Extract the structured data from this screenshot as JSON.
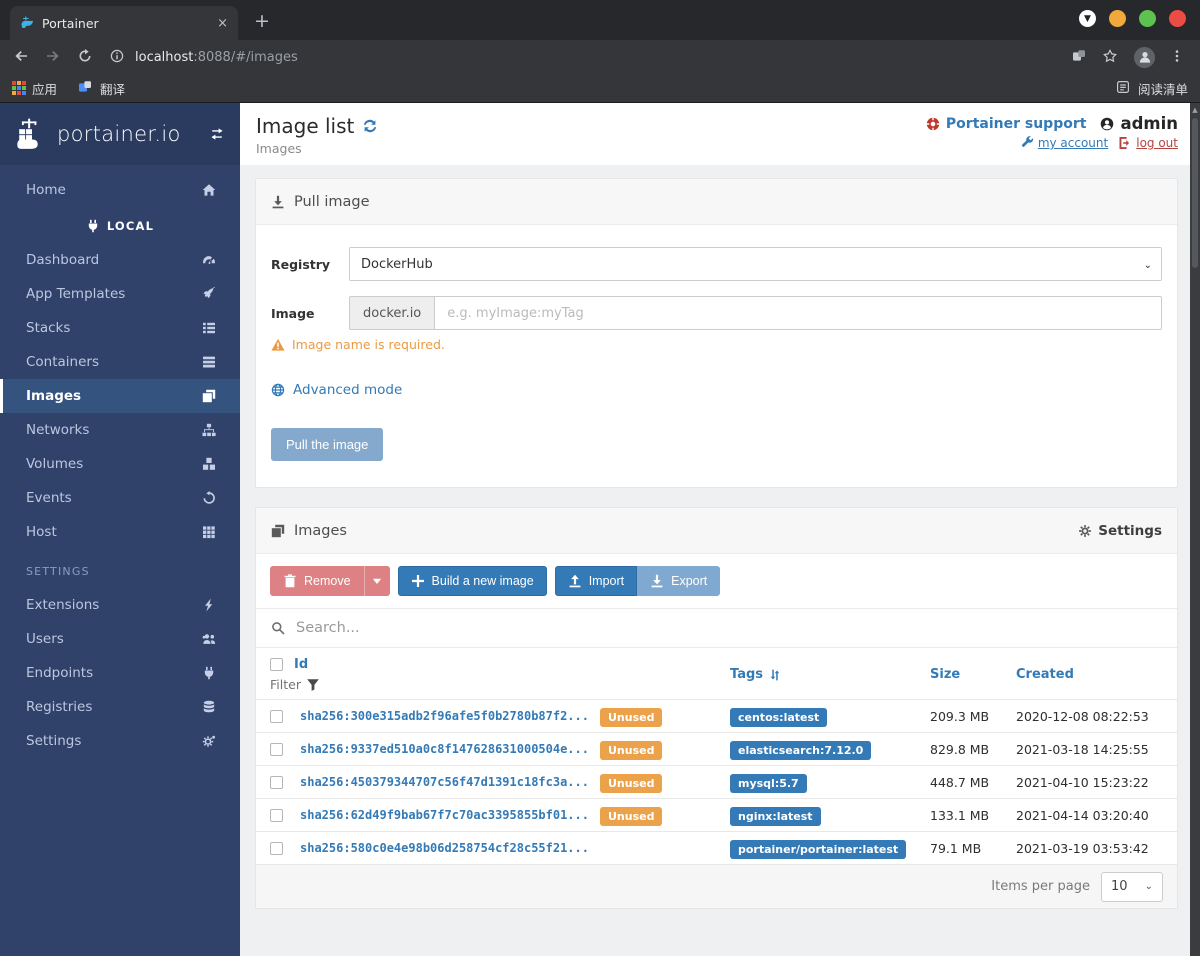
{
  "browser": {
    "tab_title": "Portainer",
    "new_tab": "+",
    "close_tab": "×",
    "url_host": "localhost",
    "url_rest": ":8088/#/images",
    "bookmarks": {
      "apps": "应用",
      "translate": "翻译",
      "reading_list": "阅读清单"
    }
  },
  "sidebar": {
    "logo_text": "portainer.io",
    "home": {
      "label": "Home",
      "icon": "home-icon"
    },
    "local_header": "LOCAL",
    "local_items": [
      {
        "label": "Dashboard",
        "icon": "dashboard-icon",
        "active": false
      },
      {
        "label": "App Templates",
        "icon": "rocket-icon",
        "active": false
      },
      {
        "label": "Stacks",
        "icon": "list-icon",
        "active": false
      },
      {
        "label": "Containers",
        "icon": "server-icon",
        "active": false
      },
      {
        "label": "Images",
        "icon": "images-icon",
        "active": true
      },
      {
        "label": "Networks",
        "icon": "sitemap-icon",
        "active": false
      },
      {
        "label": "Volumes",
        "icon": "cubes-icon",
        "active": false
      },
      {
        "label": "Events",
        "icon": "history-icon",
        "active": false
      },
      {
        "label": "Host",
        "icon": "grid-icon",
        "active": false
      }
    ],
    "settings_header": "SETTINGS",
    "settings_items": [
      {
        "label": "Extensions",
        "icon": "bolt-icon",
        "active": false
      },
      {
        "label": "Users",
        "icon": "users-icon",
        "active": false
      },
      {
        "label": "Endpoints",
        "icon": "plug-icon",
        "active": false
      },
      {
        "label": "Registries",
        "icon": "database-icon",
        "active": false
      },
      {
        "label": "Settings",
        "icon": "gears-icon",
        "active": false
      }
    ]
  },
  "header": {
    "title": "Image list",
    "breadcrumb": "Images",
    "support": "Portainer support",
    "username": "admin",
    "my_account": "my account",
    "log_out": "log out"
  },
  "pull_image": {
    "title": "Pull image",
    "registry_label": "Registry",
    "registry_value": "DockerHub",
    "image_label": "Image",
    "image_addon": "docker.io",
    "image_placeholder": "e.g. myImage:myTag",
    "warning": "Image name is required.",
    "advanced_mode": "Advanced mode",
    "pull_button": "Pull the image"
  },
  "images_panel": {
    "title": "Images",
    "settings_label": "Settings",
    "buttons": {
      "remove": "Remove",
      "build": "Build a new image",
      "import": "Import",
      "export": "Export"
    },
    "search_placeholder": "Search...",
    "columns": {
      "id": "Id",
      "filter": "Filter",
      "tags": "Tags",
      "size": "Size",
      "created": "Created"
    },
    "rows": [
      {
        "id": "sha256:300e315adb2f96afe5f0b2780b87f2...",
        "unused": "Unused",
        "tag": "centos:latest",
        "size": "209.3 MB",
        "created": "2020-12-08 08:22:53"
      },
      {
        "id": "sha256:9337ed510a0c8f147628631000504e...",
        "unused": "Unused",
        "tag": "elasticsearch:7.12.0",
        "size": "829.8 MB",
        "created": "2021-03-18 14:25:55"
      },
      {
        "id": "sha256:450379344707c56f47d1391c18fc3a...",
        "unused": "Unused",
        "tag": "mysql:5.7",
        "size": "448.7 MB",
        "created": "2021-04-10 15:23:22"
      },
      {
        "id": "sha256:62d49f9bab67f7c70ac3395855bf01...",
        "unused": "Unused",
        "tag": "nginx:latest",
        "size": "133.1 MB",
        "created": "2021-04-14 03:20:40"
      },
      {
        "id": "sha256:580c0e4e98b06d258754cf28c55f21...",
        "unused": null,
        "tag": "portainer/portainer:latest",
        "size": "79.1 MB",
        "created": "2021-03-19 03:53:42"
      }
    ],
    "pagination": {
      "label": "Items per page",
      "value": "10"
    }
  },
  "colors": {
    "accent_blue": "#337ab7",
    "badge_orange": "#eba24a",
    "warning_orange": "#eb9a43",
    "danger_red": "#dd8184",
    "sidebar_bg": "#30426a",
    "sidebar_active_bg": "#35537f",
    "logout_red": "#b5443f"
  }
}
